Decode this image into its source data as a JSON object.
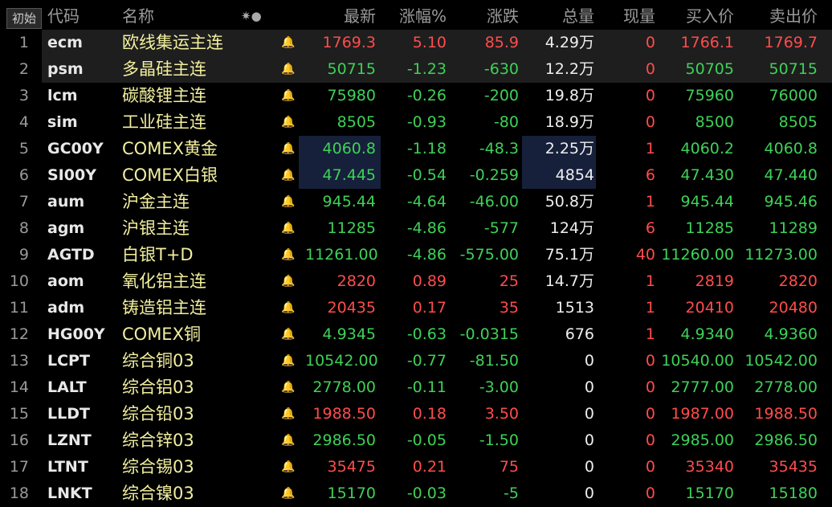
{
  "header": {
    "btn": "初始",
    "code": "代码",
    "name": "名称",
    "icons": "✷●",
    "last": "最新",
    "pct": "涨幅%",
    "chg": "涨跌",
    "vol": "总量",
    "cur": "现量",
    "bid": "买入价",
    "ask": "卖出价"
  },
  "rows": [
    {
      "n": "1",
      "code": "ecm",
      "name": "欧线集运主连",
      "last": "1769.3",
      "pct": "5.10",
      "chg": "85.9",
      "vol": "4.29万",
      "cur": "0",
      "bid": "1766.1",
      "ask": "1769.7",
      "dir": "up",
      "alert": false
    },
    {
      "n": "2",
      "code": "psm",
      "name": "多晶硅主连",
      "last": "50715",
      "pct": "-1.23",
      "chg": "-630",
      "vol": "12.2万",
      "cur": "0",
      "bid": "50705",
      "ask": "50715",
      "dir": "down",
      "alert": false
    },
    {
      "n": "3",
      "code": "lcm",
      "name": "碳酸锂主连",
      "last": "75980",
      "pct": "-0.26",
      "chg": "-200",
      "vol": "19.8万",
      "cur": "0",
      "bid": "75960",
      "ask": "76000",
      "dir": "down",
      "alert": true
    },
    {
      "n": "4",
      "code": "sim",
      "name": "工业硅主连",
      "last": "8505",
      "pct": "-0.93",
      "chg": "-80",
      "vol": "18.9万",
      "cur": "0",
      "bid": "8500",
      "ask": "8505",
      "dir": "down",
      "alert": false
    },
    {
      "n": "5",
      "code": "GC00Y",
      "name": "COMEX黄金",
      "last": "4060.8",
      "pct": "-1.18",
      "chg": "-48.3",
      "vol": "2.25万",
      "cur": "1",
      "bid": "4060.2",
      "ask": "4060.8",
      "dir": "down",
      "alert": false
    },
    {
      "n": "6",
      "code": "SI00Y",
      "name": "COMEX白银",
      "last": "47.445",
      "pct": "-0.54",
      "chg": "-0.259",
      "vol": "4854",
      "cur": "6",
      "bid": "47.430",
      "ask": "47.440",
      "dir": "down",
      "alert": false
    },
    {
      "n": "7",
      "code": "aum",
      "name": "沪金主连",
      "last": "945.44",
      "pct": "-4.64",
      "chg": "-46.00",
      "vol": "50.8万",
      "cur": "1",
      "bid": "945.44",
      "ask": "945.46",
      "dir": "down",
      "alert": false
    },
    {
      "n": "8",
      "code": "agm",
      "name": "沪银主连",
      "last": "11285",
      "pct": "-4.86",
      "chg": "-577",
      "vol": "124万",
      "cur": "6",
      "bid": "11285",
      "ask": "11289",
      "dir": "down",
      "alert": false
    },
    {
      "n": "9",
      "code": "AGTD",
      "name": "白银T+D",
      "last": "11261.00",
      "pct": "-4.86",
      "chg": "-575.00",
      "vol": "75.1万",
      "cur": "40",
      "bid": "11260.00",
      "ask": "11273.00",
      "dir": "down",
      "alert": false
    },
    {
      "n": "10",
      "code": "aom",
      "name": "氧化铝主连",
      "last": "2820",
      "pct": "0.89",
      "chg": "25",
      "vol": "14.7万",
      "cur": "1",
      "bid": "2819",
      "ask": "2820",
      "dir": "up",
      "alert": false
    },
    {
      "n": "11",
      "code": "adm",
      "name": "铸造铝主连",
      "last": "20435",
      "pct": "0.17",
      "chg": "35",
      "vol": "1513",
      "cur": "1",
      "bid": "20410",
      "ask": "20480",
      "dir": "up",
      "alert": false
    },
    {
      "n": "12",
      "code": "HG00Y",
      "name": "COMEX铜",
      "last": "4.9345",
      "pct": "-0.63",
      "chg": "-0.0315",
      "vol": "676",
      "cur": "1",
      "bid": "4.9340",
      "ask": "4.9360",
      "dir": "down",
      "alert": false
    },
    {
      "n": "13",
      "code": "LCPT",
      "name": "综合铜03",
      "last": "10542.00",
      "pct": "-0.77",
      "chg": "-81.50",
      "vol": "0",
      "cur": "0",
      "bid": "10540.00",
      "ask": "10542.00",
      "dir": "down",
      "alert": false
    },
    {
      "n": "14",
      "code": "LALT",
      "name": "综合铝03",
      "last": "2778.00",
      "pct": "-0.11",
      "chg": "-3.00",
      "vol": "0",
      "cur": "0",
      "bid": "2777.00",
      "ask": "2778.00",
      "dir": "down",
      "alert": false
    },
    {
      "n": "15",
      "code": "LLDT",
      "name": "综合铅03",
      "last": "1988.50",
      "pct": "0.18",
      "chg": "3.50",
      "vol": "0",
      "cur": "0",
      "bid": "1987.00",
      "ask": "1988.50",
      "dir": "up",
      "alert": false
    },
    {
      "n": "16",
      "code": "LZNT",
      "name": "综合锌03",
      "last": "2986.50",
      "pct": "-0.05",
      "chg": "-1.50",
      "vol": "0",
      "cur": "0",
      "bid": "2985.00",
      "ask": "2986.50",
      "dir": "down",
      "alert": false
    },
    {
      "n": "17",
      "code": "LTNT",
      "name": "综合锡03",
      "last": "35475",
      "pct": "0.21",
      "chg": "75",
      "vol": "0",
      "cur": "0",
      "bid": "35340",
      "ask": "35435",
      "dir": "up",
      "alert": false
    },
    {
      "n": "18",
      "code": "LNKT",
      "name": "综合镍03",
      "last": "15170",
      "pct": "-0.03",
      "chg": "-5",
      "vol": "0",
      "cur": "0",
      "bid": "15170",
      "ask": "15180",
      "dir": "down",
      "alert": false
    }
  ]
}
